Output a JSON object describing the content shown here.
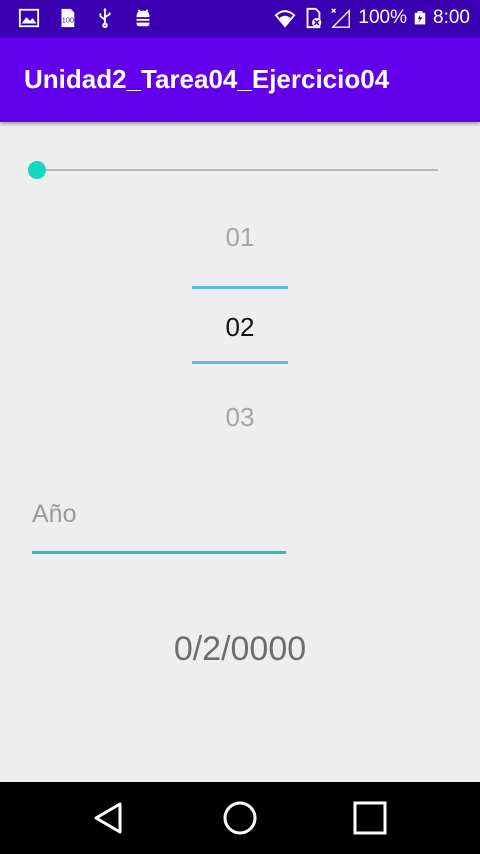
{
  "status_bar": {
    "battery_percent": "100%",
    "time": "8:00",
    "left_icons": [
      "gallery-icon",
      "sd-card-icon",
      "usb-icon",
      "android-debug-icon"
    ],
    "right_icons": [
      "wifi-icon",
      "no-sim-icon",
      "signal-icon",
      "battery-icon"
    ]
  },
  "app_bar": {
    "title": "Unidad2_Tarea04_Ejercicio04",
    "color": "#6200ee"
  },
  "seekbar": {
    "value": 0,
    "accent": "#14d6c4"
  },
  "picker": {
    "previous": "01",
    "selected": "02",
    "next": "03"
  },
  "year_input": {
    "placeholder": "Año",
    "value": ""
  },
  "result": {
    "text": "0/2/0000"
  },
  "nav_bar": {
    "icons": [
      "back-icon",
      "home-icon",
      "recent-apps-icon"
    ]
  }
}
